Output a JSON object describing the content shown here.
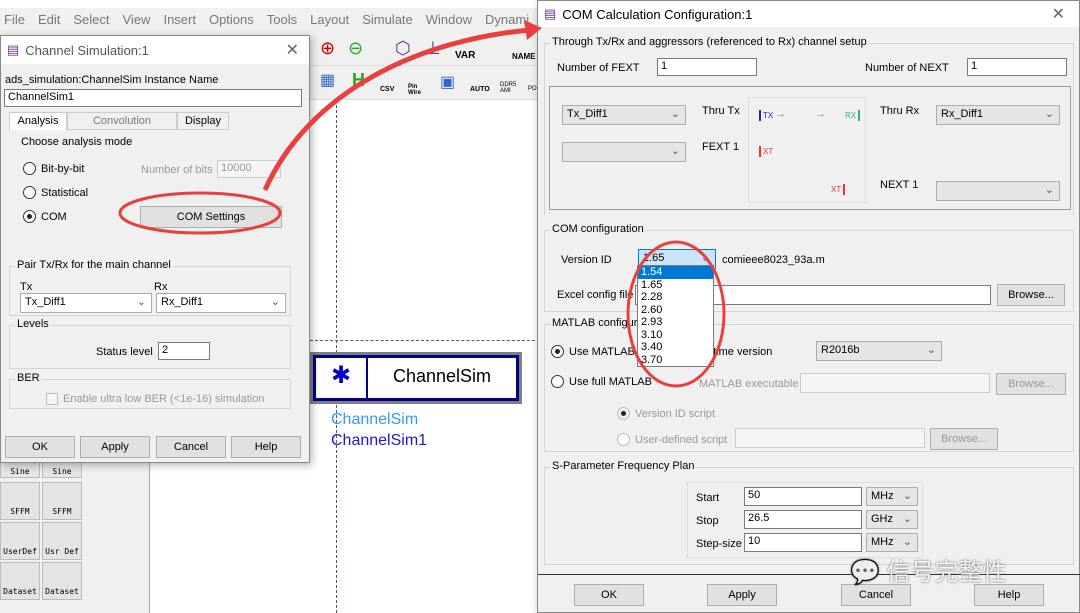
{
  "app": {
    "menu": [
      "File",
      "Edit",
      "Select",
      "View",
      "Insert",
      "Options",
      "Tools",
      "Layout",
      "Simulate",
      "Window",
      "Dynami"
    ],
    "toolbar_labels": [
      "VAR",
      "NAME",
      "CSV",
      "Pin Wire",
      "AUTO",
      "DDR5 AMI",
      "PO"
    ],
    "palette": [
      "Sine",
      "Sine",
      "SFFM",
      "SFFM",
      "UserDef",
      "Usr Def",
      "Dataset",
      "Dataset"
    ],
    "schematic": {
      "component_label": "ChannelSim",
      "instance_type": "ChannelSim",
      "instance_name": "ChannelSim1"
    }
  },
  "channel_sim": {
    "title": "Channel Simulation:1",
    "instance_label": "ads_simulation:ChannelSim Instance Name",
    "instance_value": "ChannelSim1",
    "tabs": [
      "Analysis",
      "Convolution",
      "Display"
    ],
    "mode_group": "Choose analysis mode",
    "modes": [
      "Bit-by-bit",
      "Statistical",
      "COM"
    ],
    "selected_mode": "COM",
    "num_bits_label": "Number of bits",
    "num_bits_value": "10000",
    "com_settings": "COM Settings",
    "pair_group": "Pair Tx/Rx for the main channel",
    "tx_label": "Tx",
    "tx_value": "Tx_Diff1",
    "rx_label": "Rx",
    "rx_value": "Rx_Diff1",
    "levels_group": "Levels",
    "status_label": "Status level",
    "status_value": "2",
    "ber_group": "BER",
    "ber_checkbox": "Enable ultra low BER (<1e-16) simulation",
    "buttons": [
      "OK",
      "Apply",
      "Cancel",
      "Help"
    ]
  },
  "com": {
    "title": "COM Calculation Configuration:1",
    "channel_group": "Through Tx/Rx and aggressors (referenced to Rx) channel setup",
    "fext_label": "Number of FEXT",
    "fext_value": "1",
    "next_label": "Number of NEXT",
    "next_value": "1",
    "thru_tx_select": "Tx_Diff1",
    "thru_tx": "Thru Tx",
    "fext1": "FEXT 1",
    "thru_rx": "Thru Rx",
    "thru_rx_select": "Rx_Diff1",
    "next1": "NEXT 1",
    "diagram": {
      "tx": "TX",
      "rx": "RX",
      "xt": "XT"
    },
    "config_group": "COM configuration",
    "version_label": "Version ID",
    "version_value": "1.65",
    "version_file": "comieee8023_93a.m",
    "version_options": [
      "1.54",
      "1.65",
      "2.28",
      "2.60",
      "2.93",
      "3.10",
      "3.40",
      "3.70"
    ],
    "highlighted_option": "1.54",
    "excel_label": "Excel config file",
    "browse": "Browse...",
    "matlab_group": "MATLAB configura",
    "use_runtime": "Use MATLAB Ru",
    "runtime_version_label": "ntime version",
    "runtime_version": "R2016b",
    "use_full": "Use full MATLAB",
    "matlab_exe": "MATLAB executable",
    "version_script": "Version ID script",
    "user_script": "User-defined script",
    "freq_group": "S-Parameter Frequency Plan",
    "freq": [
      {
        "label": "Start",
        "value": "50",
        "unit": "MHz"
      },
      {
        "label": "Stop",
        "value": "26.5",
        "unit": "GHz"
      },
      {
        "label": "Step-size",
        "value": "10",
        "unit": "MHz"
      }
    ],
    "buttons": [
      "OK",
      "Apply",
      "Cancel",
      "Help"
    ]
  },
  "watermark": "信号完整性",
  "annotation_color": "#e8403f"
}
